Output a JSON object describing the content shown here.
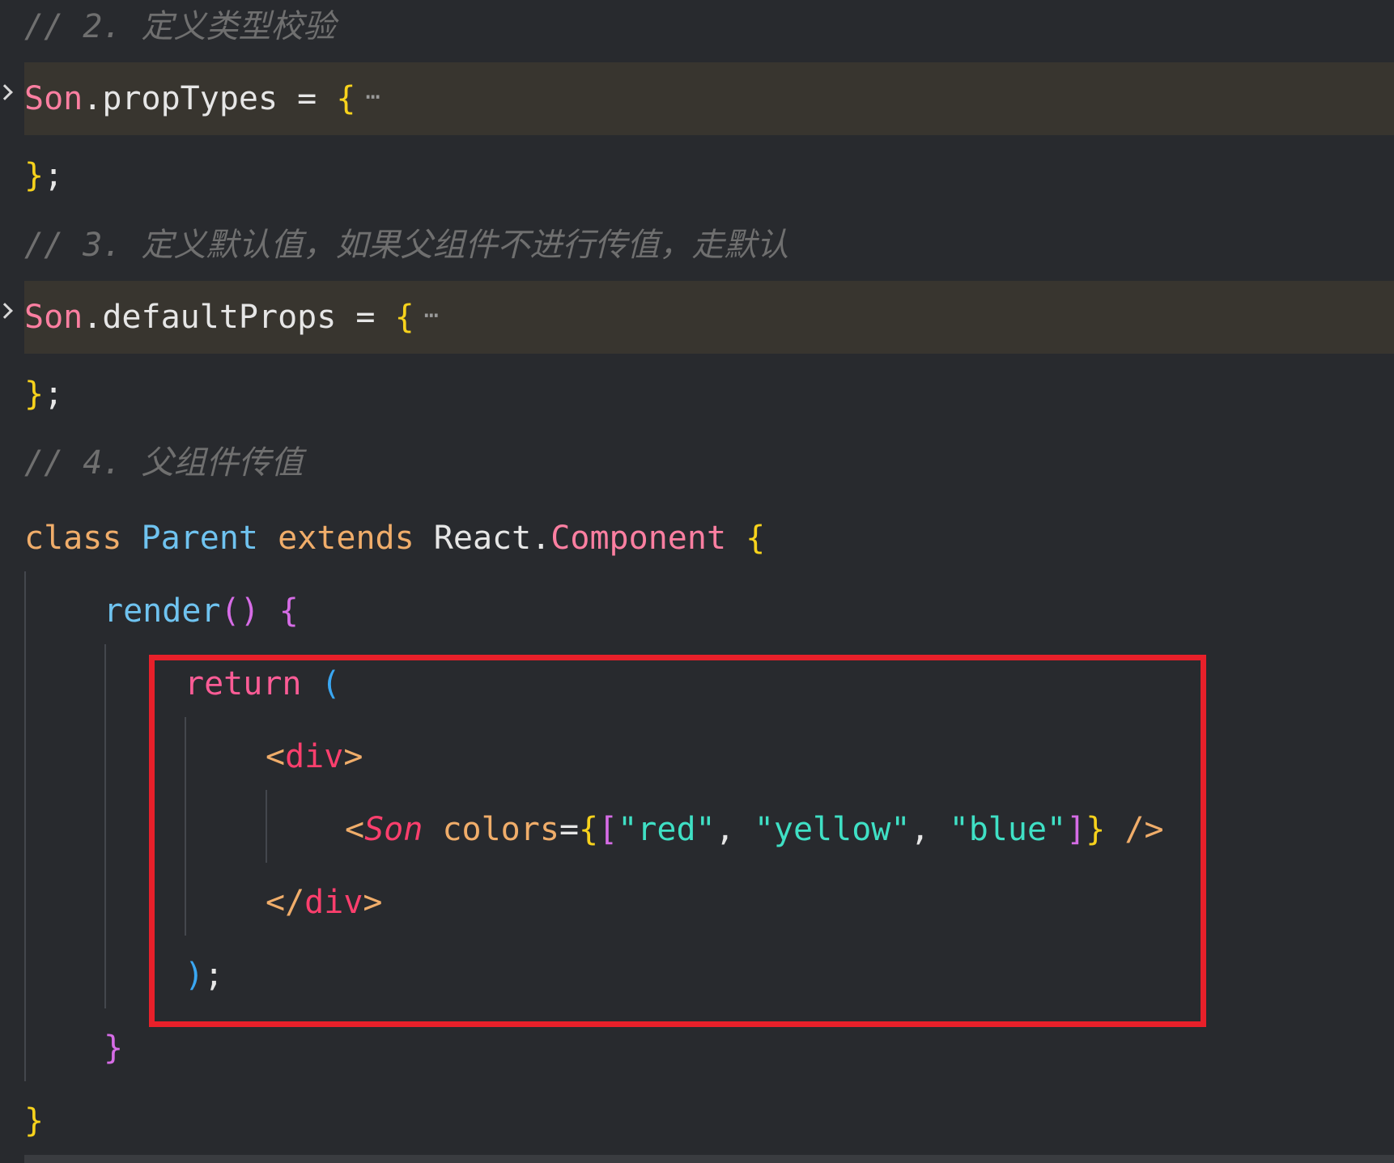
{
  "editor": {
    "comment_2": "// 2. 定义类型校验",
    "comment_3": "// 3. 定义默认值，如果父组件不进行传值，走默认",
    "comment_4": "// 4. 父组件传值",
    "fold_ellipsis": "⋯",
    "line_proptypes": {
      "object": "Son",
      "dot": ".",
      "prop": "propTypes",
      "op": " = ",
      "brace": "{"
    },
    "line_defaultprops": {
      "object": "Son",
      "dot": ".",
      "prop": "defaultProps",
      "op": " = ",
      "brace": "{"
    },
    "close_brace": "}",
    "semicolon": ";",
    "class_line": {
      "kw_class": "class",
      "class_name": "Parent",
      "kw_extends": "extends",
      "base_object": "React",
      "dot": ".",
      "base_class": "Component",
      "brace": "{"
    },
    "render_line": {
      "method": "render",
      "parens": "()",
      "brace": "{"
    },
    "return_line": {
      "kw_return": "return",
      "paren": "("
    },
    "div_open": {
      "lt": "<",
      "tag": "div",
      "gt": ">"
    },
    "son_line": {
      "lt": "<",
      "component": "Son",
      "attr": "colors",
      "eq": "=",
      "brace_open": "{",
      "bracket_open": "[",
      "str_red": "\"red\"",
      "comma1": ", ",
      "str_yellow": "\"yellow\"",
      "comma2": ", ",
      "str_blue": "\"blue\"",
      "bracket_close": "]",
      "brace_close": "}",
      "self_close": "/>"
    },
    "div_close": {
      "lt_slash": "</",
      "tag": "div",
      "gt": ">"
    },
    "return_close": {
      "paren": ")",
      "semicolon": ";"
    },
    "render_close": "}",
    "class_close": "}"
  },
  "colors": {
    "background": "#282a2e",
    "folded_background": "#38352f",
    "highlight_border": "#e8202a"
  }
}
